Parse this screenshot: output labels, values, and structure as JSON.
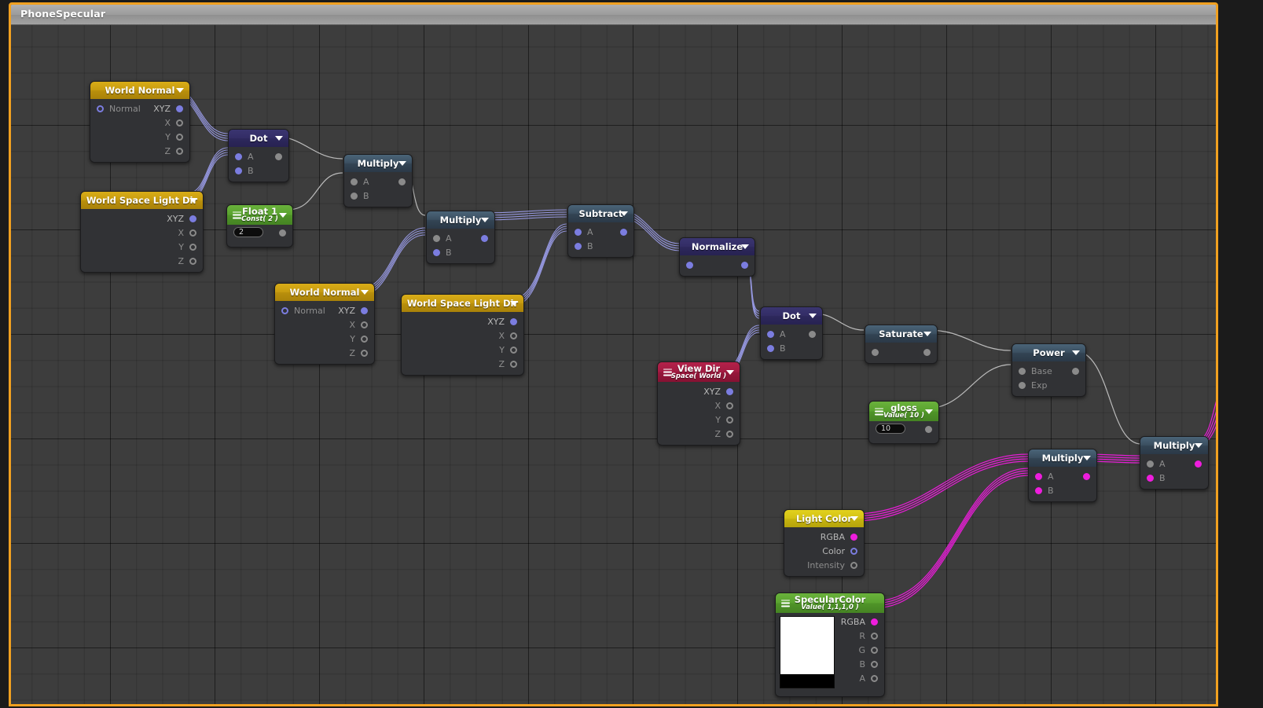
{
  "window": {
    "title": "PhoneSpecular"
  },
  "theme": {
    "frame_border": "#f0a020",
    "canvas_bg": "#3d3d3d",
    "wire_vector": "#9a9ce8",
    "wire_scalar": "#c9c9c9",
    "wire_color": "#ee1ddd",
    "port_vector": "#7b7de0",
    "port_scalar": "#8a8a8a",
    "port_color": "#ee1ddd"
  },
  "nodes": [
    {
      "id": "world-normal-1",
      "title": "World Normal",
      "subtitle": "",
      "header_style": "h-gold",
      "inputs": [
        {
          "label": "Normal",
          "dot": "hollow-blue"
        }
      ],
      "outputs": [
        {
          "label": "XYZ",
          "dot": "blue"
        },
        {
          "label": "X",
          "dot": "hollow-gray"
        },
        {
          "label": "Y",
          "dot": "hollow-gray"
        },
        {
          "label": "Z",
          "dot": "hollow-gray"
        }
      ]
    },
    {
      "id": "world-space-light-dir-1",
      "title": "World Space Light Dir",
      "subtitle": "",
      "header_style": "h-gold",
      "inputs": [],
      "outputs": [
        {
          "label": "XYZ",
          "dot": "blue"
        },
        {
          "label": "X",
          "dot": "hollow-gray"
        },
        {
          "label": "Y",
          "dot": "hollow-gray"
        },
        {
          "label": "Z",
          "dot": "hollow-gray"
        }
      ]
    },
    {
      "id": "dot-1",
      "title": "Dot",
      "subtitle": "",
      "header_style": "h-indigo",
      "inputs": [
        {
          "label": "A",
          "dot": "blue"
        },
        {
          "label": "B",
          "dot": "blue"
        }
      ],
      "outputs": [
        {
          "label": "",
          "dot": "gray"
        }
      ]
    },
    {
      "id": "float-1",
      "title": "Float 1",
      "subtitle": "Const( 2 )",
      "header_style": "h-green",
      "value": "2",
      "inputs": [],
      "outputs": [
        {
          "label": "",
          "dot": "gray"
        }
      ]
    },
    {
      "id": "multiply-1",
      "title": "Multiply",
      "subtitle": "",
      "header_style": "h-blue",
      "inputs": [
        {
          "label": "A",
          "dot": "gray"
        },
        {
          "label": "B",
          "dot": "gray"
        }
      ],
      "outputs": [
        {
          "label": "",
          "dot": "gray"
        }
      ]
    },
    {
      "id": "multiply-2",
      "title": "Multiply",
      "subtitle": "",
      "header_style": "h-blue",
      "inputs": [
        {
          "label": "A",
          "dot": "gray"
        },
        {
          "label": "B",
          "dot": "blue"
        }
      ],
      "outputs": [
        {
          "label": "",
          "dot": "blue"
        }
      ]
    },
    {
      "id": "world-normal-2",
      "title": "World Normal",
      "subtitle": "",
      "header_style": "h-gold",
      "inputs": [
        {
          "label": "Normal",
          "dot": "hollow-blue"
        }
      ],
      "outputs": [
        {
          "label": "XYZ",
          "dot": "blue"
        },
        {
          "label": "X",
          "dot": "hollow-gray"
        },
        {
          "label": "Y",
          "dot": "hollow-gray"
        },
        {
          "label": "Z",
          "dot": "hollow-gray"
        }
      ]
    },
    {
      "id": "world-space-light-dir-2",
      "title": "World Space Light Dir",
      "subtitle": "",
      "header_style": "h-gold",
      "inputs": [],
      "outputs": [
        {
          "label": "XYZ",
          "dot": "blue"
        },
        {
          "label": "X",
          "dot": "hollow-gray"
        },
        {
          "label": "Y",
          "dot": "hollow-gray"
        },
        {
          "label": "Z",
          "dot": "hollow-gray"
        }
      ]
    },
    {
      "id": "subtract-1",
      "title": "Subtract",
      "subtitle": "",
      "header_style": "h-blue",
      "inputs": [
        {
          "label": "A",
          "dot": "blue"
        },
        {
          "label": "B",
          "dot": "blue"
        }
      ],
      "outputs": [
        {
          "label": "",
          "dot": "blue"
        }
      ]
    },
    {
      "id": "normalize-1",
      "title": "Normalize",
      "subtitle": "",
      "header_style": "h-indigo",
      "inputs": [
        {
          "label": "",
          "dot": "blue"
        }
      ],
      "outputs": [
        {
          "label": "",
          "dot": "blue"
        }
      ]
    },
    {
      "id": "view-dir-1",
      "title": "View Dir",
      "subtitle": "Space( World )",
      "header_style": "h-crimson",
      "inputs": [],
      "outputs": [
        {
          "label": "XYZ",
          "dot": "blue"
        },
        {
          "label": "X",
          "dot": "hollow-gray"
        },
        {
          "label": "Y",
          "dot": "hollow-gray"
        },
        {
          "label": "Z",
          "dot": "hollow-gray"
        }
      ]
    },
    {
      "id": "dot-2",
      "title": "Dot",
      "subtitle": "",
      "header_style": "h-indigo",
      "inputs": [
        {
          "label": "A",
          "dot": "blue"
        },
        {
          "label": "B",
          "dot": "blue"
        }
      ],
      "outputs": [
        {
          "label": "",
          "dot": "gray"
        }
      ]
    },
    {
      "id": "saturate-1",
      "title": "Saturate",
      "subtitle": "",
      "header_style": "h-blue",
      "inputs": [
        {
          "label": "",
          "dot": "gray"
        }
      ],
      "outputs": [
        {
          "label": "",
          "dot": "gray"
        }
      ]
    },
    {
      "id": "gloss-1",
      "title": "gloss",
      "subtitle": "Value( 10 )",
      "header_style": "h-green",
      "value": "10",
      "inputs": [],
      "outputs": [
        {
          "label": "",
          "dot": "gray"
        }
      ]
    },
    {
      "id": "power-1",
      "title": "Power",
      "subtitle": "",
      "header_style": "h-blue",
      "inputs": [
        {
          "label": "Base",
          "dot": "gray"
        },
        {
          "label": "Exp",
          "dot": "gray"
        }
      ],
      "outputs": [
        {
          "label": "",
          "dot": "gray"
        }
      ]
    },
    {
      "id": "light-color-1",
      "title": "Light Color",
      "subtitle": "",
      "header_style": "h-yellow",
      "inputs": [],
      "outputs": [
        {
          "label": "RGBA",
          "dot": "pink"
        },
        {
          "label": "Color",
          "dot": "hollow-blue"
        },
        {
          "label": "Intensity",
          "dot": "hollow-gray"
        }
      ]
    },
    {
      "id": "specular-color-1",
      "title": "SpecularColor",
      "subtitle": "Value( 1,1,1,0 )",
      "header_style": "h-green",
      "swatch_color": "#ffffff",
      "inputs": [],
      "outputs": [
        {
          "label": "RGBA",
          "dot": "pink"
        },
        {
          "label": "R",
          "dot": "hollow-gray"
        },
        {
          "label": "G",
          "dot": "hollow-gray"
        },
        {
          "label": "B",
          "dot": "hollow-gray"
        },
        {
          "label": "A",
          "dot": "hollow-gray"
        }
      ]
    },
    {
      "id": "multiply-3",
      "title": "Multiply",
      "subtitle": "",
      "header_style": "h-blue",
      "inputs": [
        {
          "label": "A",
          "dot": "pink"
        },
        {
          "label": "B",
          "dot": "pink"
        }
      ],
      "outputs": [
        {
          "label": "",
          "dot": "pink"
        }
      ]
    },
    {
      "id": "multiply-4",
      "title": "Multiply",
      "subtitle": "",
      "header_style": "h-blue",
      "inputs": [
        {
          "label": "A",
          "dot": "gray"
        },
        {
          "label": "B",
          "dot": "pink"
        }
      ],
      "outputs": [
        {
          "label": "",
          "dot": "pink"
        }
      ]
    }
  ]
}
